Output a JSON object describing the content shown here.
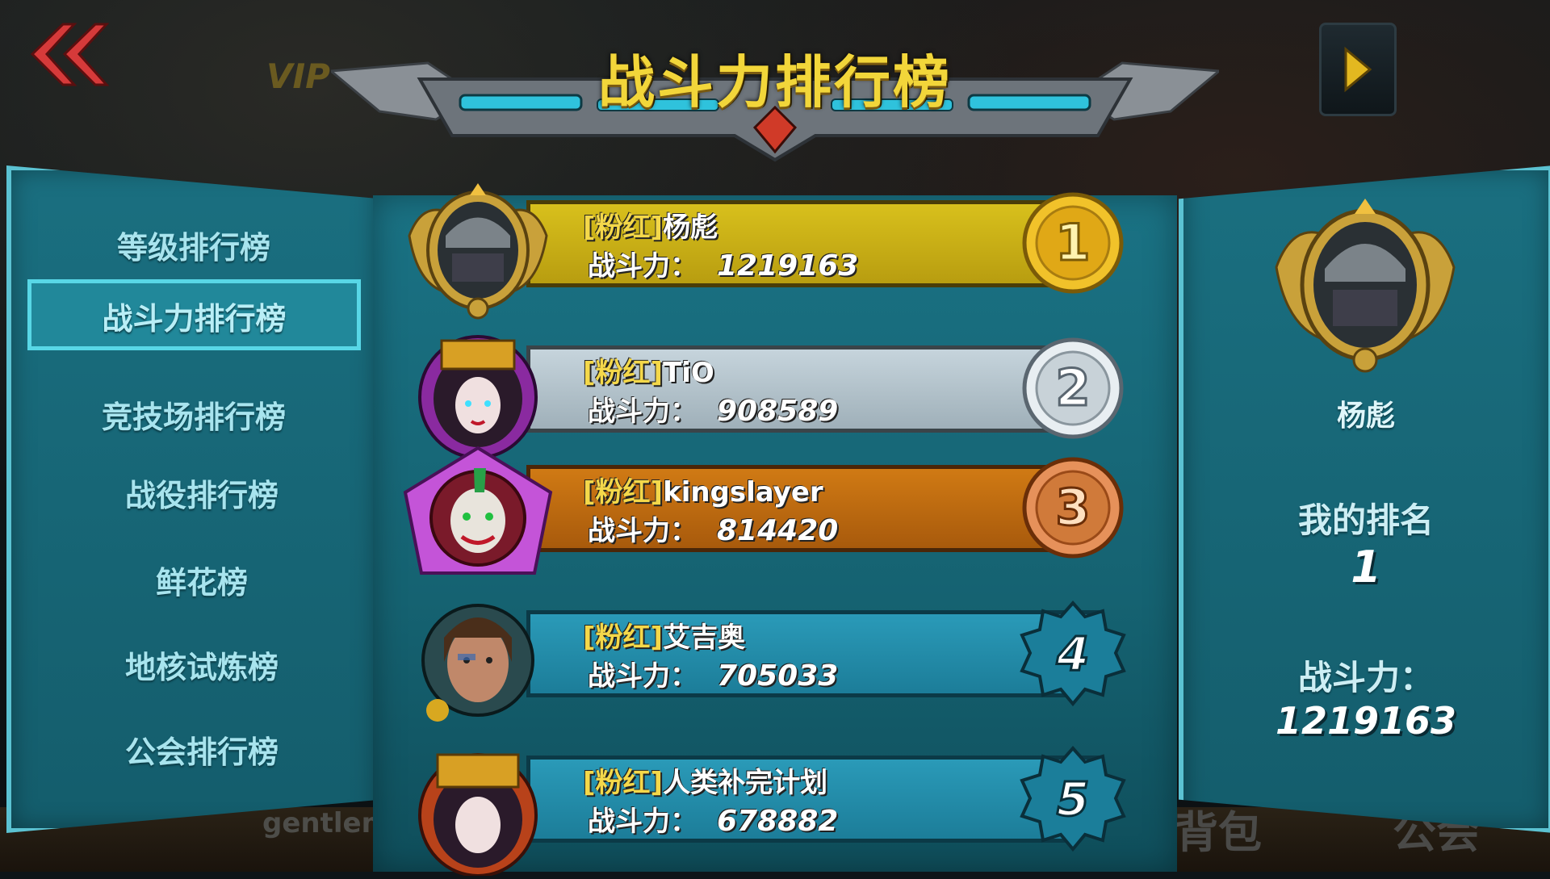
{
  "header": {
    "title": "战斗力排行榜"
  },
  "menu": {
    "items": [
      {
        "label": "等级排行榜"
      },
      {
        "label": "战斗力排行榜",
        "active": true
      },
      {
        "label": "竞技场排行榜"
      },
      {
        "label": "战役排行榜"
      },
      {
        "label": "鲜花榜"
      },
      {
        "label": "地核试炼榜"
      },
      {
        "label": "公会排行榜"
      }
    ]
  },
  "rankings": [
    {
      "rank": "1",
      "tag": "[粉红]",
      "name": "杨彪",
      "power_label": "战斗力：",
      "power": "1219163",
      "style": "gold"
    },
    {
      "rank": "2",
      "tag": "[粉红]",
      "name": "TiO",
      "power_label": "战斗力：",
      "power": "908589",
      "style": "silver"
    },
    {
      "rank": "3",
      "tag": "[粉红]",
      "name": "kingslayer",
      "power_label": "战斗力：",
      "power": "814420",
      "style": "bronze"
    },
    {
      "rank": "4",
      "tag": "[粉红]",
      "name": "艾吉奥",
      "power_label": "战斗力：",
      "power": "705033",
      "style": "blue"
    },
    {
      "rank": "5",
      "tag": "[粉红]",
      "name": "人类补完计划",
      "power_label": "战斗力：",
      "power": "678882",
      "style": "blue"
    }
  ],
  "my_info": {
    "name": "杨彪",
    "rank_label": "我的排名",
    "rank_value": "1",
    "power_label": "战斗力：",
    "power_value": "1219163"
  },
  "background": {
    "vip": "VIP",
    "gentleman": "gentleman",
    "bag": "背包",
    "guild": "公会"
  },
  "colors": {
    "title": "#f2d63a",
    "panel": "#1a6f80",
    "panel_border": "#5bc2d2",
    "gold": "#d8c01c",
    "silver": "#c6d4dc",
    "bronze": "#d07a14",
    "blue": "#2a9ab8"
  }
}
